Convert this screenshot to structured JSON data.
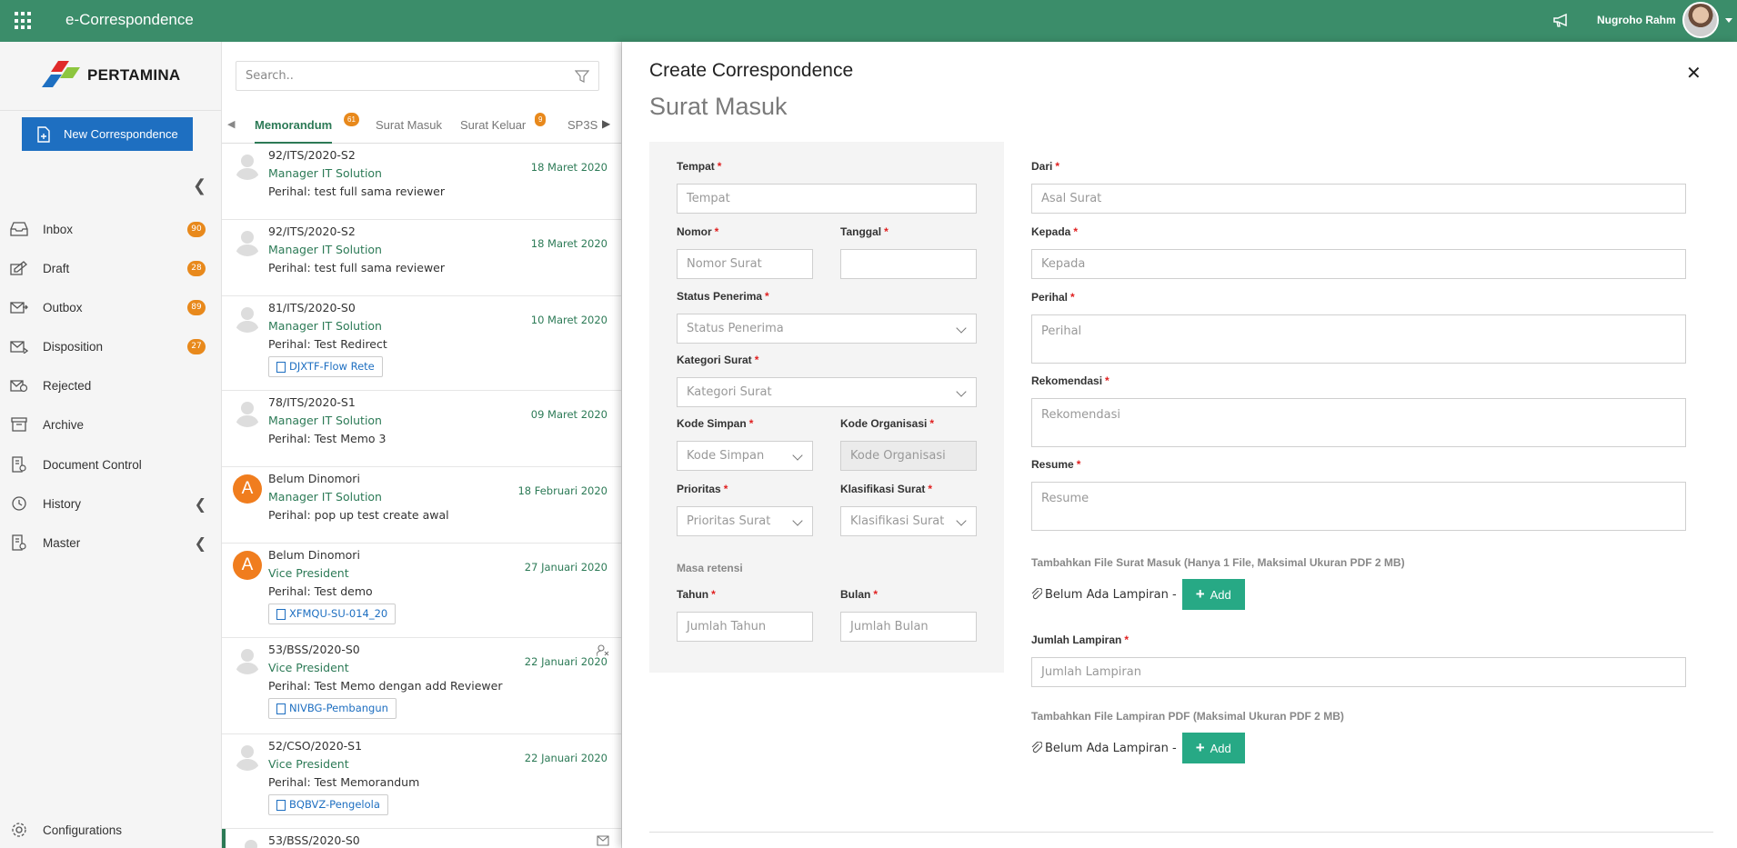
{
  "app": {
    "title": "e-Correspondence"
  },
  "user": {
    "name": "Nugroho Rahm"
  },
  "brand": {
    "name": "PERTAMINA",
    "colors": {
      "primary": "#3b8d6a",
      "button_blue": "#1e6fc1",
      "badge": "#e8891c",
      "add_green": "#27a985"
    }
  },
  "sidebar": {
    "new_button": "New Correspondence",
    "items": [
      {
        "label": "Inbox",
        "icon": "inbox-icon",
        "badge": "90"
      },
      {
        "label": "Draft",
        "icon": "draft-icon",
        "badge": "28"
      },
      {
        "label": "Outbox",
        "icon": "outbox-icon",
        "badge": "89"
      },
      {
        "label": "Disposition",
        "icon": "disposition-icon",
        "badge": "27"
      },
      {
        "label": "Rejected",
        "icon": "rejected-icon"
      },
      {
        "label": "Archive",
        "icon": "archive-icon"
      },
      {
        "label": "Document Control",
        "icon": "document-control-icon"
      },
      {
        "label": "History",
        "icon": "history-icon"
      },
      {
        "label": "Master",
        "icon": "master-icon"
      }
    ],
    "configurations": "Configurations"
  },
  "list": {
    "search_placeholder": "Search..",
    "tabs": [
      {
        "label": "Memorandum",
        "badge": "61"
      },
      {
        "label": "Surat Masuk"
      },
      {
        "label": "Surat Keluar",
        "badge": "9"
      },
      {
        "label": "SP3S"
      }
    ],
    "items": [
      {
        "title": "92/ITS/2020-S2",
        "from": "Manager IT Solution",
        "date": "18 Maret 2020",
        "subject": "Perihal: test full sama reviewer"
      },
      {
        "title": "92/ITS/2020-S2",
        "from": "Manager IT Solution",
        "date": "18 Maret 2020",
        "subject": "Perihal: test full sama reviewer"
      },
      {
        "title": "81/ITS/2020-S0",
        "from": "Manager IT Solution",
        "date": "10 Maret 2020",
        "subject": "Perihal: Test Redirect",
        "attachment": "DJXTF-Flow Rete"
      },
      {
        "title": "78/ITS/2020-S1",
        "from": "Manager IT Solution",
        "date": "09 Maret 2020",
        "subject": "Perihal: Test Memo 3"
      },
      {
        "title": "Belum Dinomori",
        "from": "Manager IT Solution",
        "date": "18 Februari 2020",
        "subject": "Perihal: pop up test create awal",
        "avatar_letter": "A"
      },
      {
        "title": "Belum Dinomori",
        "from": "Vice President",
        "date": "27 Januari 2020",
        "subject": "Perihal: Test demo",
        "attachment": "XFMQU-SU-014_20",
        "avatar_letter": "A"
      },
      {
        "title": "53/BSS/2020-S0",
        "from": "Vice President",
        "date": "22 Januari 2020",
        "subject": "Perihal: Test Memo dengan add Reviewer",
        "attachment": "NIVBG-Pembangun"
      },
      {
        "title": "52/CSO/2020-S1",
        "from": "Vice President",
        "date": "22 Januari 2020",
        "subject": "Perihal: Test Memorandum",
        "attachment": "BQBVZ-Pengelola"
      },
      {
        "title": "53/BSS/2020-S0"
      }
    ]
  },
  "modal": {
    "title": "Create Correspondence",
    "subtitle": "Surat Masuk",
    "fields": {
      "tempat": {
        "label": "Tempat",
        "placeholder": "Tempat"
      },
      "nomor": {
        "label": "Nomor",
        "placeholder": "Nomor Surat"
      },
      "tanggal": {
        "label": "Tanggal",
        "placeholder": ""
      },
      "status_penerima": {
        "label": "Status Penerima",
        "placeholder": "Status Penerima"
      },
      "kategori_surat": {
        "label": "Kategori Surat",
        "placeholder": "Kategori Surat"
      },
      "kode_simpan": {
        "label": "Kode Simpan",
        "placeholder": "Kode Simpan"
      },
      "kode_organisasi": {
        "label": "Kode Organisasi",
        "placeholder": "Kode Organisasi"
      },
      "prioritas": {
        "label": "Prioritas",
        "placeholder": "Prioritas Surat"
      },
      "klasifikasi": {
        "label": "Klasifikasi Surat",
        "placeholder": "Klasifikasi Surat"
      },
      "masa_retensi": {
        "label": "Masa retensi"
      },
      "tahun": {
        "label": "Tahun",
        "placeholder": "Jumlah Tahun"
      },
      "bulan": {
        "label": "Bulan",
        "placeholder": "Jumlah Bulan"
      },
      "dari": {
        "label": "Dari",
        "placeholder": "Asal Surat"
      },
      "kepada": {
        "label": "Kepada",
        "placeholder": "Kepada"
      },
      "perihal": {
        "label": "Perihal",
        "placeholder": "Perihal"
      },
      "rekomendasi": {
        "label": "Rekomendasi",
        "placeholder": "Rekomendasi"
      },
      "resume": {
        "label": "Resume",
        "placeholder": "Resume"
      },
      "jumlah_lampiran": {
        "label": "Jumlah Lampiran",
        "placeholder": "Jumlah Lampiran"
      }
    },
    "file_surat_note": "Tambahkan File Surat Masuk (Hanya 1 File, Maksimal Ukuran PDF 2 MB)",
    "file_lampiran_note": "Tambahkan File Lampiran PDF (Maksimal Ukuran PDF 2 MB)",
    "no_attachment": "Belum Ada Lampiran -",
    "add_label": "Add",
    "required_mark": "*"
  }
}
